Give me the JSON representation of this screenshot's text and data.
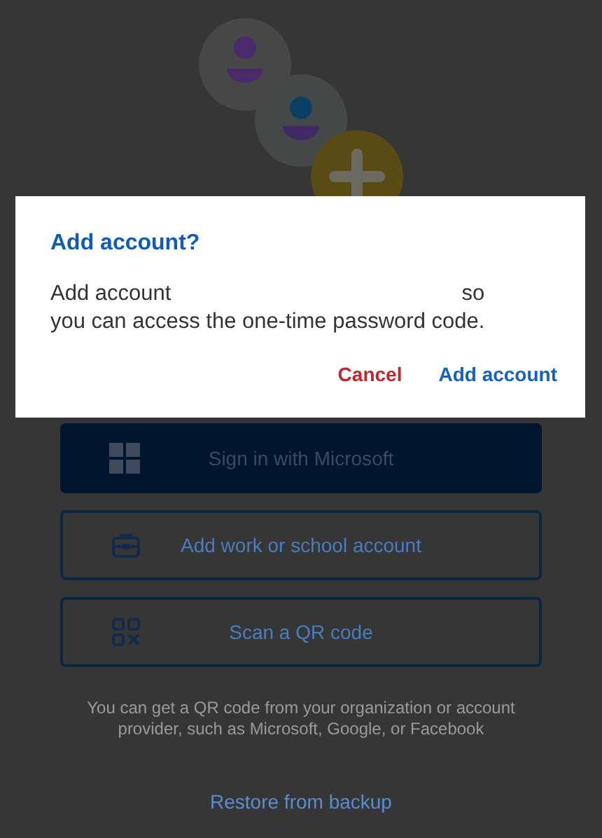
{
  "page": {
    "buttons": [
      {
        "kind": "primary",
        "label": "Sign in with Microsoft"
      },
      {
        "kind": "outline",
        "label": "Add work or school account"
      },
      {
        "kind": "outline",
        "label": "Scan a QR code"
      }
    ],
    "hint": "You can get a QR code from your organization or account provider, such as Microsoft, Google, or Facebook",
    "restore_link": "Restore from backup"
  },
  "dialog": {
    "title": "Add account?",
    "body_line_1": [
      "Add account",
      "so"
    ],
    "body_line_2": "you can access the one-time password code.",
    "actions": [
      {
        "kind": "cancel",
        "label": "Cancel"
      },
      {
        "kind": "confirm",
        "label": "Add account"
      }
    ]
  }
}
